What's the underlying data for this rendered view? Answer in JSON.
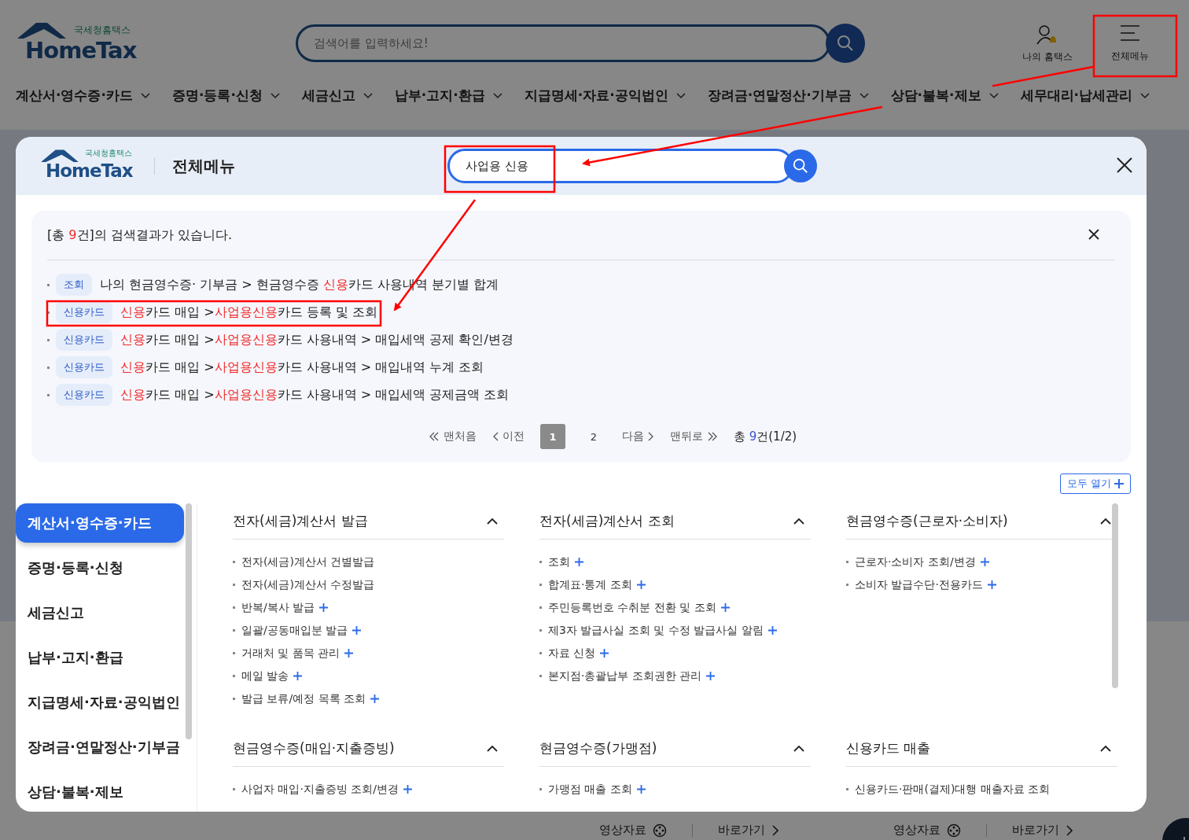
{
  "header": {
    "logo_small": "국세청홈택스",
    "logo": "HomeTax",
    "search": {
      "placeholder": "검색어를 입력하세요!"
    },
    "my_label": "나의 홈택스",
    "menu_label": "전체메뉴"
  },
  "nav": [
    "계산서·영수증·카드",
    "증명·등록·신청",
    "세금신고",
    "납부·고지·환급",
    "지급명세·자료·공익법인",
    "장려금·연말정산·기부금",
    "상담·불복·제보",
    "세무대리·납세관리"
  ],
  "bottom_links": [
    {
      "video": "영상자료",
      "go": "바로가기"
    },
    {
      "video": "영상자료",
      "go": "바로가기"
    }
  ],
  "modal": {
    "logo_small": "국세청홈택스",
    "logo": "HomeTax",
    "title": "전체메뉴",
    "search_value": "사업용 신용",
    "results": {
      "summary": [
        {
          "text": "[총 ",
          "match": false
        },
        {
          "text": "9",
          "match": true
        },
        {
          "text": "건]의 검색결과가 있습니다.",
          "match": false
        }
      ],
      "rows": [
        {
          "tag": "조회",
          "parts": [
            {
              "text": "나의 현금영수증· 기부금 > 현금영수증 ",
              "match": false
            },
            {
              "text": "신용",
              "match": true
            },
            {
              "text": "카드 사용내역 분기별 합계",
              "match": false
            }
          ]
        },
        {
          "tag": "신용카드",
          "parts": [
            {
              "text": "신용",
              "match": true
            },
            {
              "text": "카드 매입 >",
              "match": false
            },
            {
              "text": "사업용신용",
              "match": true
            },
            {
              "text": "카드 등록 및 조회",
              "match": false
            }
          ]
        },
        {
          "tag": "신용카드",
          "parts": [
            {
              "text": "신용",
              "match": true
            },
            {
              "text": "카드 매입 >",
              "match": false
            },
            {
              "text": "사업용신용",
              "match": true
            },
            {
              "text": "카드 사용내역 > 매입세액 공제 확인/변경",
              "match": false
            }
          ]
        },
        {
          "tag": "신용카드",
          "parts": [
            {
              "text": "신용",
              "match": true
            },
            {
              "text": "카드 매입 >",
              "match": false
            },
            {
              "text": "사업용신용",
              "match": true
            },
            {
              "text": "카드 사용내역 > 매입내역 누계 조회",
              "match": false
            }
          ]
        },
        {
          "tag": "신용카드",
          "parts": [
            {
              "text": "신용",
              "match": true
            },
            {
              "text": "카드 매입 >",
              "match": false
            },
            {
              "text": "사업용신용",
              "match": true
            },
            {
              "text": "카드 사용내역 > 매입세액 공제금액 조회",
              "match": false
            }
          ]
        }
      ],
      "pager": {
        "first": "맨처음",
        "prev": "이전",
        "pages": [
          {
            "label": "1",
            "selected": true
          },
          {
            "label": "2",
            "selected": false
          }
        ],
        "next": "다음",
        "last": "맨뒤로",
        "total": [
          {
            "text": "총 ",
            "match": false
          },
          {
            "text": "9",
            "match": true
          },
          {
            "text": "건(1/2)",
            "match": false
          }
        ]
      }
    },
    "open_all": "모두 열기",
    "categories": [
      {
        "label": "계산서·영수증·카드",
        "selected": true
      },
      {
        "label": "증명·등록·신청",
        "selected": false
      },
      {
        "label": "세금신고",
        "selected": false
      },
      {
        "label": "납부·고지·환급",
        "selected": false
      },
      {
        "label": "지급명세·자료·공익법인",
        "selected": false
      },
      {
        "label": "장려금·연말정산·기부금",
        "selected": false
      },
      {
        "label": "상담·불복·제보",
        "selected": false
      }
    ],
    "sections": [
      {
        "title": "전자(세금)계산서 발급",
        "expanded": true,
        "items": [
          {
            "label": "전자(세금)계산서 건별발급",
            "plus": false
          },
          {
            "label": "전자(세금)계산서 수정발급",
            "plus": false
          },
          {
            "label": "반복/복사 발급",
            "plus": true
          },
          {
            "label": "일괄/공동매입분 발급",
            "plus": true
          },
          {
            "label": "거래처 및 품목 관리",
            "plus": true
          },
          {
            "label": "메일 발송",
            "plus": true
          },
          {
            "label": "발급 보류/예정 목록 조회",
            "plus": true
          }
        ]
      },
      {
        "title": "전자(세금)계산서 조회",
        "expanded": true,
        "items": [
          {
            "label": "조회",
            "plus": true
          },
          {
            "label": "합계표·통계 조회",
            "plus": true
          },
          {
            "label": "주민등록번호 수취분 전환 및 조회",
            "plus": true
          },
          {
            "label": "제3자 발급사실 조회 및 수정 발급사실 알림",
            "plus": true
          },
          {
            "label": "자료 신청",
            "plus": true
          },
          {
            "label": "본지점·총괄납부 조회권한 관리",
            "plus": true
          }
        ]
      },
      {
        "title": "현금영수증(근로자·소비자)",
        "expanded": true,
        "items": [
          {
            "label": "근로자·소비자 조회/변경",
            "plus": true
          },
          {
            "label": "소비자 발급수단·전용카드",
            "plus": true
          }
        ]
      },
      {
        "title": "현금영수증(매입·지출증빙)",
        "expanded": true,
        "items": [
          {
            "label": "사업자 매입·지출증빙 조회/변경",
            "plus": true
          }
        ]
      },
      {
        "title": "현금영수증(가맹점)",
        "expanded": true,
        "items": [
          {
            "label": "가맹점 매출 조회",
            "plus": true
          }
        ]
      },
      {
        "title": "신용카드 매출",
        "expanded": true,
        "items": [
          {
            "label": "신용카드·판매(결제)대행 매출자료 조회",
            "plus": false
          }
        ]
      }
    ]
  }
}
